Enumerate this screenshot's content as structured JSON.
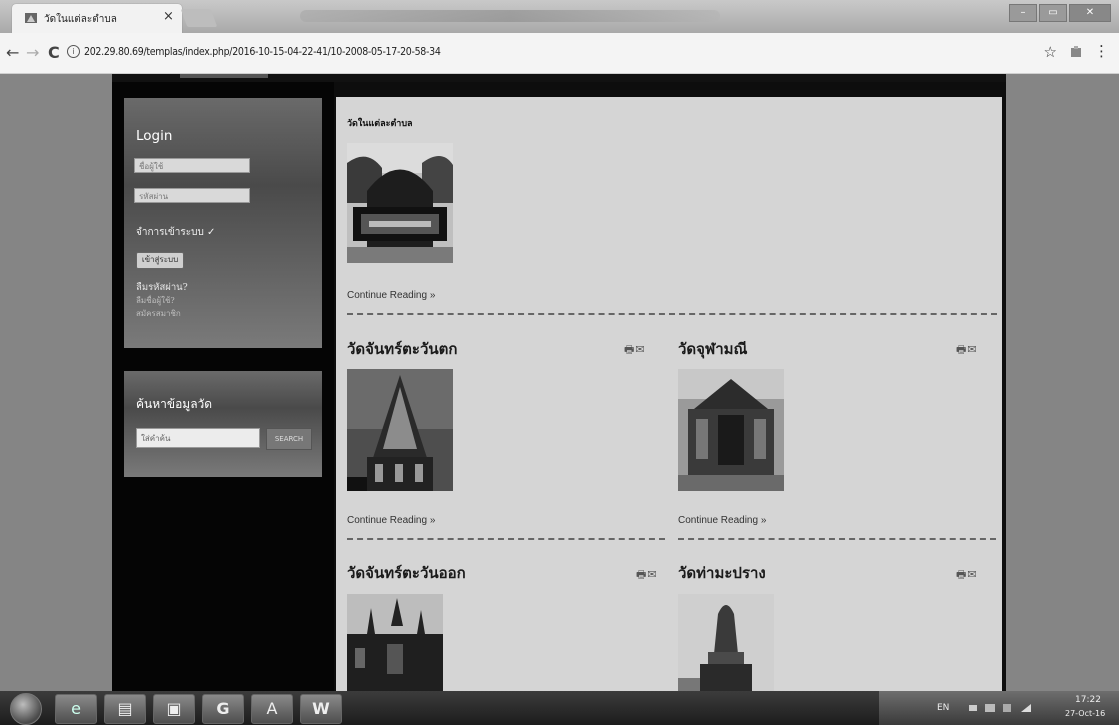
{
  "browser": {
    "tab_title": "วัดในแต่ละตำบล",
    "tab_close": "×",
    "url": "202.29.80.69/templas/index.php/2016-10-15-04-22-41/10-2008-05-17-20-58-34",
    "back": "←",
    "forward": "→",
    "reload": "C",
    "info": "i",
    "star": "☆",
    "menu": "⋮",
    "win_min": "–",
    "win_max": "▭",
    "win_close": "✕"
  },
  "sidebar": {
    "login": {
      "title": "Login",
      "username_placeholder": "ชื่อผู้ใช้",
      "password_placeholder": "รหัสผ่าน",
      "remember_label": "จำการเข้าระบบ ✓",
      "submit_label": "เข้าสู่ระบบ",
      "forgot_password": "ลืมรหัสผ่าน?",
      "forgot_username": "ลืมชื่อผู้ใช้?",
      "register": "สมัครสมาชิก"
    },
    "search": {
      "title": "ค้นหาข้อมูลวัด",
      "placeholder": "ใส่คำค้น",
      "button_label": "SEARCH"
    }
  },
  "content": {
    "section_title": "วัดในแต่ละตำบล",
    "intro_continue": "Continue Reading »",
    "articles": [
      {
        "title": "วัดจันทร์ตะวันตก",
        "continue": "Continue Reading »"
      },
      {
        "title": "วัดจุฬามณี",
        "continue": "Continue Reading »"
      },
      {
        "title": "วัดจันทร์ตะวันออก",
        "continue": ""
      },
      {
        "title": "วัดท่ามะปราง",
        "continue": ""
      }
    ],
    "article_icons": "🖶✉"
  },
  "taskbar": {
    "apps": [
      "e",
      "▤",
      "▣",
      "G",
      "A",
      "W"
    ],
    "tray_lang": "EN",
    "clock_time": "17:22",
    "clock_date": "27-Oct-16"
  }
}
